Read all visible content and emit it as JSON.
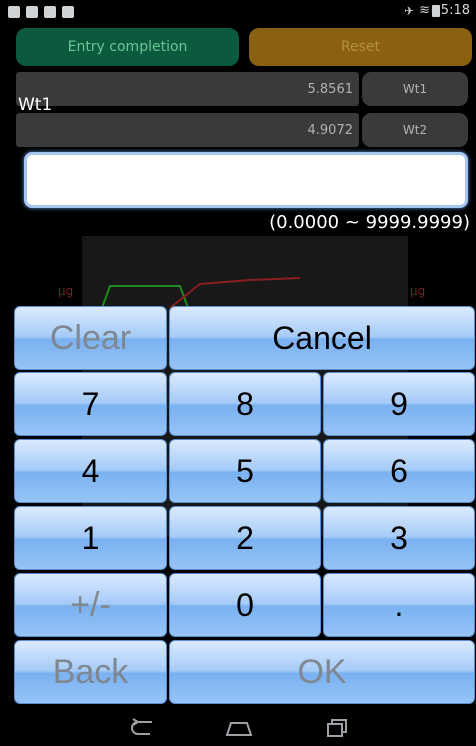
{
  "status_bar": {
    "time": "5:18"
  },
  "top_buttons": {
    "entry_completion": "Entry completion",
    "reset": "Reset"
  },
  "weights": [
    {
      "value": "5.8561",
      "button": "Wt1"
    },
    {
      "value": "4.9072",
      "button": "Wt2"
    }
  ],
  "wt_label": "Wt1",
  "input": {
    "value": ""
  },
  "range": "(0.0000 ~ 9999.9999)",
  "graph": {
    "unit_left": "μg",
    "unit_right": "μg"
  },
  "keypad": {
    "clear": "Clear",
    "cancel": "Cancel",
    "k7": "7",
    "k8": "8",
    "k9": "9",
    "k4": "4",
    "k5": "5",
    "k6": "6",
    "k1": "1",
    "k2": "2",
    "k3": "3",
    "plusminus": "+/-",
    "k0": "0",
    "dot": ".",
    "back": "Back",
    "ok": "OK"
  },
  "colors": {
    "accent_blue": "#8fc0f5",
    "entry_green": "#0c5a3e",
    "reset_orange": "#8a6111"
  }
}
